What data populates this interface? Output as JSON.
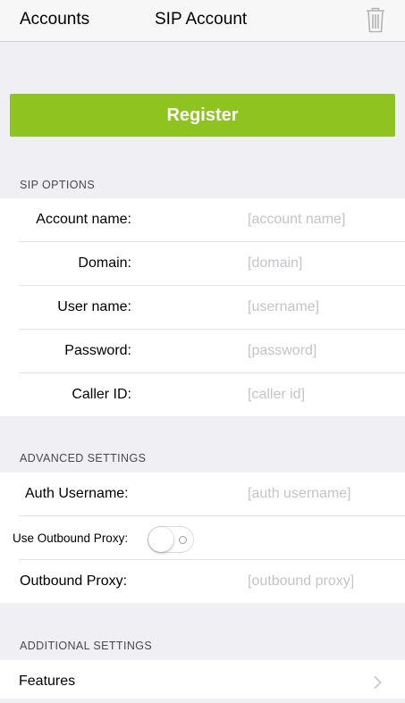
{
  "navbar": {
    "back_label": "Accounts",
    "title": "SIP Account",
    "delete_icon": "trash-icon"
  },
  "register_button": {
    "label": "Register",
    "color": "#8fc31f"
  },
  "sip_options": {
    "header": "SIP OPTIONS",
    "fields": [
      {
        "label": "Account name:",
        "placeholder": "[account name]"
      },
      {
        "label": "Domain:",
        "placeholder": "[domain]"
      },
      {
        "label": "User name:",
        "placeholder": "[username]"
      },
      {
        "label": "Password:",
        "placeholder": "[password]"
      },
      {
        "label": "Caller ID:",
        "placeholder": "[caller id]"
      }
    ]
  },
  "advanced_settings": {
    "header": "ADVANCED SETTINGS",
    "auth_username": {
      "label": "Auth Username:",
      "placeholder": "[auth username]"
    },
    "use_outbound_proxy": {
      "label": "Use Outbound Proxy:",
      "enabled": false
    },
    "outbound_proxy": {
      "label": "Outbound Proxy:",
      "placeholder": "[outbound proxy]"
    }
  },
  "additional_settings": {
    "header": "ADDITIONAL SETTINGS",
    "features": {
      "label": "Features",
      "icon": "chevron-right-icon"
    }
  }
}
